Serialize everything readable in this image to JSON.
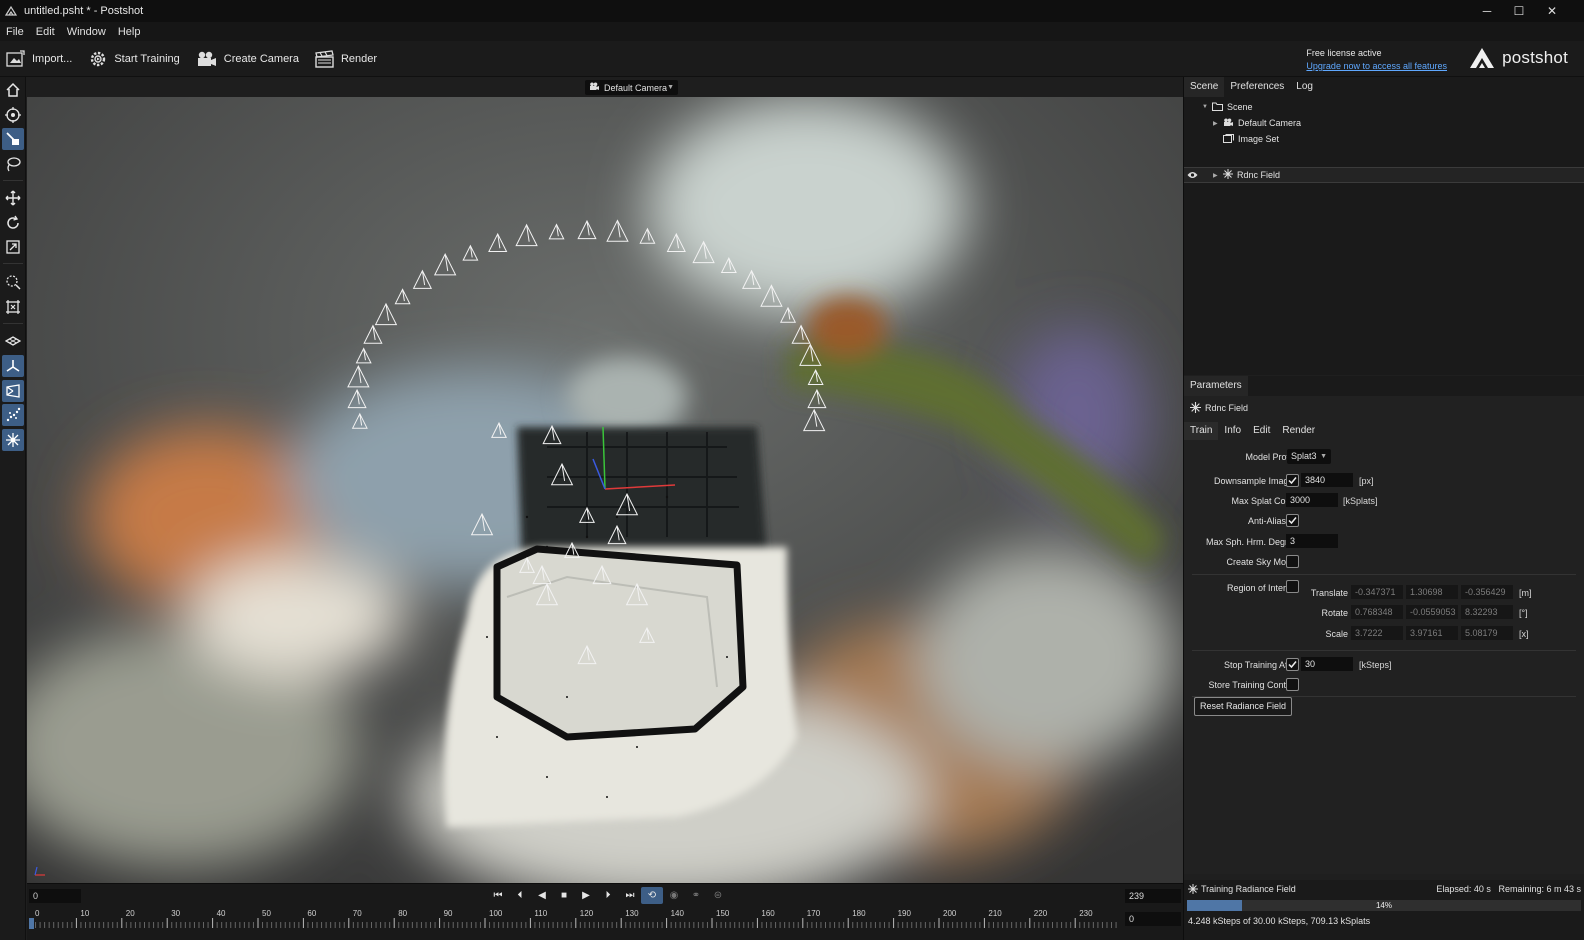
{
  "window": {
    "title": "untitled.psht * - Postshot",
    "controls": {
      "minimize": "─",
      "maximize": "☐",
      "close": "✕"
    }
  },
  "menu": [
    "File",
    "Edit",
    "Window",
    "Help"
  ],
  "toolbar": {
    "import_label": "Import...",
    "start_training_label": "Start Training",
    "create_camera_label": "Create Camera",
    "render_label": "Render"
  },
  "license": {
    "status": "Free license active",
    "upgrade_link": "Upgrade now to access all features"
  },
  "brand": {
    "name": "postshot"
  },
  "viewport": {
    "camera_select": "Default Camera",
    "colors": {
      "accent": "#3d5e86",
      "axis_x": "#e03a3a",
      "axis_y": "#3ac43a",
      "axis_z": "#3a5ae0"
    }
  },
  "left_tools": [
    {
      "name": "home-icon",
      "active": false
    },
    {
      "name": "orbit-target-icon",
      "active": false
    },
    {
      "name": "select-splat-icon",
      "active": true
    },
    {
      "name": "lasso-icon",
      "active": false
    },
    {
      "name": "move-icon",
      "active": false
    },
    {
      "name": "rotate-icon",
      "active": false
    },
    {
      "name": "scale-icon",
      "active": false
    },
    {
      "name": "box-select-icon",
      "active": false
    },
    {
      "name": "crop-icon",
      "active": false
    },
    {
      "name": "grid-plane-icon",
      "active": false
    },
    {
      "name": "axis-gizmo-icon",
      "active": true
    },
    {
      "name": "camera-frustum-icon",
      "active": true
    },
    {
      "name": "point-cloud-icon",
      "active": true
    },
    {
      "name": "radiance-field-icon",
      "active": true
    }
  ],
  "timeline": {
    "frame_start": "0",
    "frame_end": "239",
    "frame_current": "0",
    "tick_labels": [
      "0",
      "10",
      "20",
      "30",
      "40",
      "50",
      "60",
      "70",
      "80",
      "90",
      "100",
      "110",
      "120",
      "130",
      "140",
      "150",
      "160",
      "170",
      "180",
      "190",
      "200",
      "210",
      "220",
      "230"
    ],
    "transport": [
      {
        "name": "skip-to-start-icon",
        "glyph": "⏮",
        "active": false,
        "dim": false
      },
      {
        "name": "step-back-icon",
        "glyph": "⏴",
        "active": false,
        "dim": false
      },
      {
        "name": "play-reverse-icon",
        "glyph": "◀",
        "active": false,
        "dim": false
      },
      {
        "name": "stop-icon",
        "glyph": "■",
        "active": false,
        "dim": false
      },
      {
        "name": "play-icon",
        "glyph": "▶",
        "active": false,
        "dim": false
      },
      {
        "name": "step-forward-icon",
        "glyph": "⏵",
        "active": false,
        "dim": false
      },
      {
        "name": "skip-to-end-icon",
        "glyph": "⏭",
        "active": false,
        "dim": false
      },
      {
        "name": "loop-icon",
        "glyph": "⟲",
        "active": true,
        "dim": false
      },
      {
        "name": "record-icon",
        "glyph": "◉",
        "active": false,
        "dim": true
      },
      {
        "name": "ping-pong-icon",
        "glyph": "⚭",
        "active": false,
        "dim": true
      },
      {
        "name": "keyframe-icon",
        "glyph": "⊜",
        "active": false,
        "dim": true
      }
    ]
  },
  "scene_panel": {
    "tabs": [
      "Scene",
      "Preferences",
      "Log"
    ],
    "tree": {
      "root": "Scene",
      "items": [
        "Default Camera",
        "Image Set",
        "Rdnc Field"
      ]
    }
  },
  "parameters": {
    "tab": "Parameters",
    "node": "Rdnc Field",
    "sub_tabs": [
      "Train",
      "Info",
      "Edit",
      "Render"
    ],
    "model_profile": {
      "label": "Model Profile",
      "value": "Splat3"
    },
    "downsample": {
      "label": "Downsample Images",
      "checked": true,
      "value": "3840",
      "unit": "[px]"
    },
    "max_splat": {
      "label": "Max Splat Count",
      "value": "3000",
      "unit": "[kSplats]"
    },
    "anti_aliasing": {
      "label": "Anti-Aliasing",
      "checked": true
    },
    "max_sph": {
      "label": "Max Sph. Hrm. Degree",
      "value": "3"
    },
    "sky_model": {
      "label": "Create Sky Model",
      "checked": false
    },
    "roi": {
      "label": "Region of Interest",
      "checked": false,
      "translate": {
        "label": "Translate",
        "values": [
          "-0.347371",
          "1.30698",
          "-0.356429"
        ],
        "unit": "[m]"
      },
      "rotate": {
        "label": "Rotate",
        "values": [
          "0.768348",
          "-0.0559053",
          "8.32293"
        ],
        "unit": "[°]"
      },
      "scale": {
        "label": "Scale",
        "values": [
          "3.7222",
          "3.97161",
          "5.08179"
        ],
        "unit": "[x]"
      }
    },
    "stop_after": {
      "label": "Stop Training After",
      "checked": true,
      "value": "30",
      "unit": "[kSteps]"
    },
    "store_context": {
      "label": "Store Training Context",
      "checked": false
    },
    "reset_button": "Reset Radiance Field"
  },
  "status": {
    "title": "Training Radiance Field",
    "elapsed": "Elapsed: 40 s",
    "remaining": "Remaining: 6 m 43 s",
    "progress": 0.14,
    "progress_label": "14%",
    "detail": "4.248 kSteps of 30.00 kSteps, 709.13 kSplats"
  }
}
